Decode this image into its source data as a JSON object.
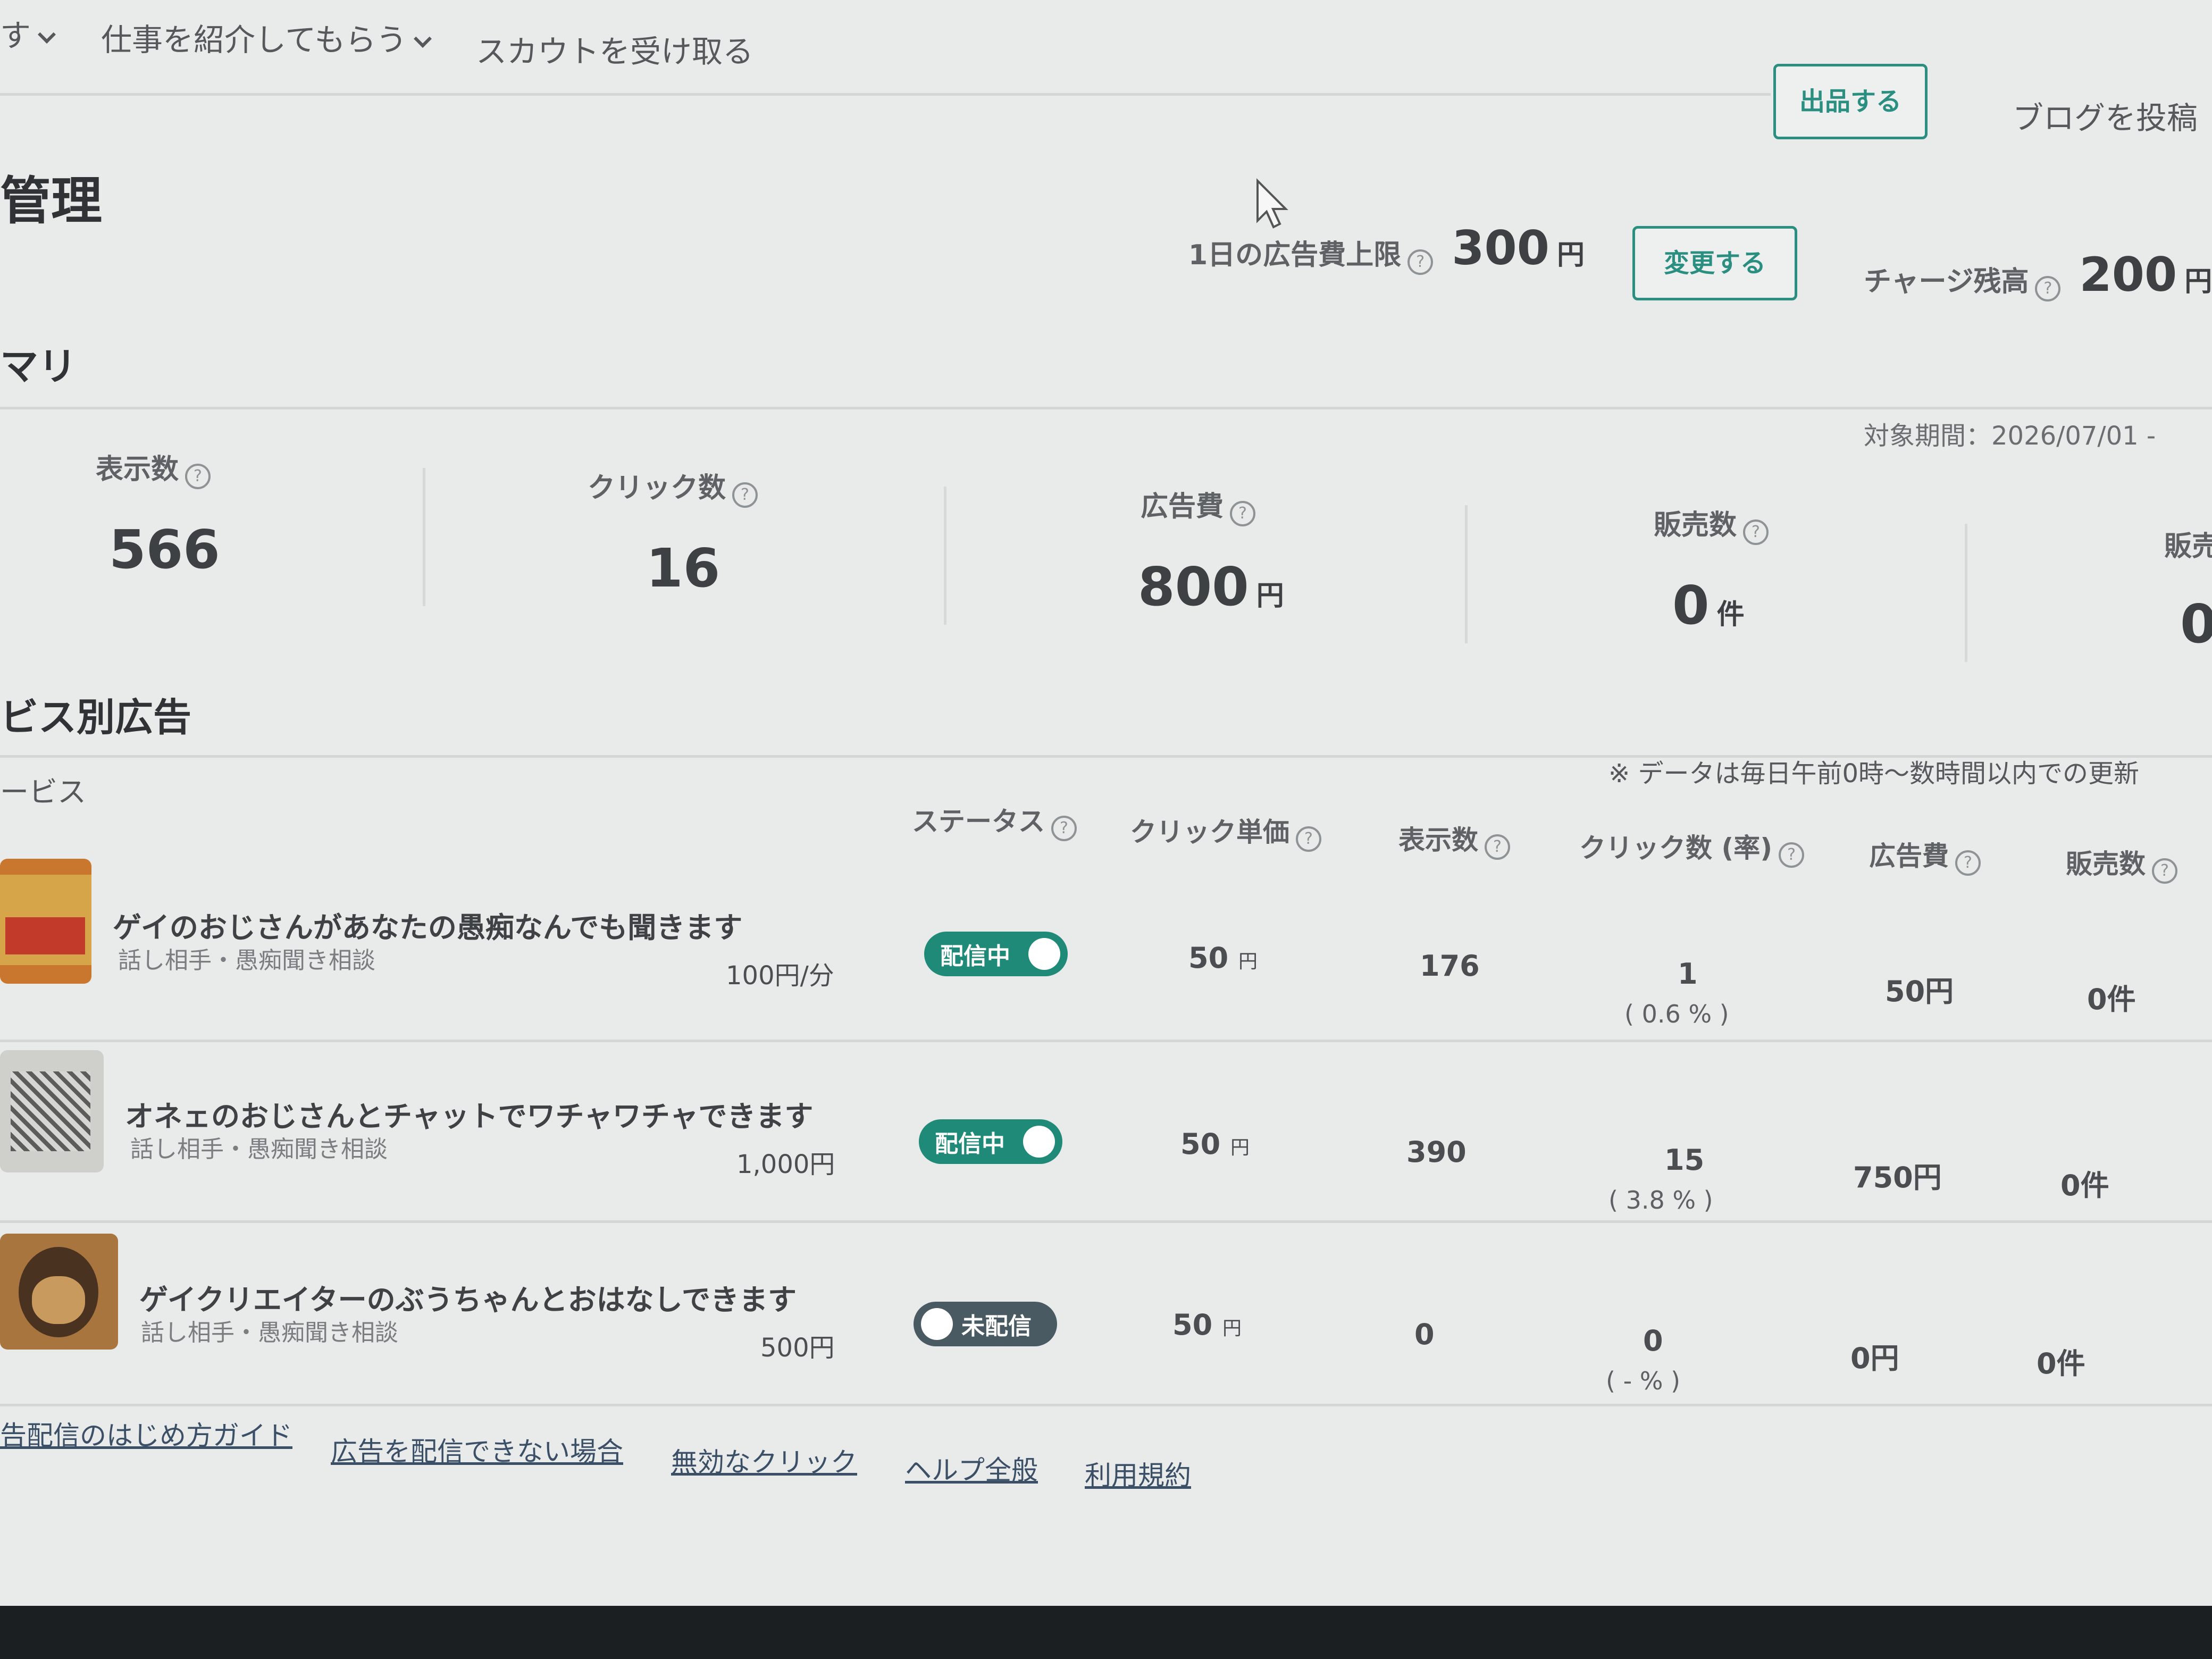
{
  "nav": {
    "item0": "す",
    "item1": "仕事を紹介してもらう",
    "item2": "スカウトを受け取る",
    "sell_button": "出品する",
    "blog_button": "ブログを投稿"
  },
  "page": {
    "title": "管理",
    "daily_limit_label": "1日の広告費上限",
    "daily_limit_value": "300",
    "daily_limit_unit": "円",
    "change_button": "変更する",
    "balance_label": "チャージ残高",
    "balance_value": "200",
    "balance_unit": "円"
  },
  "summary": {
    "heading": "マリ",
    "period": "対象期間：2026/07/01 -",
    "metrics": [
      {
        "label": "表示数",
        "value": "566",
        "unit": ""
      },
      {
        "label": "クリック数",
        "value": "16",
        "unit": ""
      },
      {
        "label": "広告費",
        "value": "800",
        "unit": "円"
      },
      {
        "label": "販売数",
        "value": "0",
        "unit": "件"
      },
      {
        "label": "販売",
        "value": "0",
        "unit": ""
      }
    ]
  },
  "services": {
    "heading": "ビス別広告",
    "column_service": "ービス",
    "update_note": "※ データは毎日午前0時〜数時間以内での更新",
    "columns": {
      "status": "ステータス",
      "cpc": "クリック単価",
      "impressions": "表示数",
      "clicks": "クリック数 (率)",
      "ad_cost": "広告費",
      "sales": "販売数"
    },
    "rows": [
      {
        "title": "ゲイのおじさんがあなたの愚痴なんでも聞きます",
        "category": "話し相手・愚痴聞き相談",
        "price": "100円/分",
        "status": "配信中",
        "status_on": true,
        "cpc": "50",
        "cpc_unit": "円",
        "impressions": "176",
        "clicks": "1",
        "rate": "( 0.6 % )",
        "ad_cost": "50円",
        "sales": "0件"
      },
      {
        "title": "オネェのおじさんとチャットでワチャワチャできます",
        "category": "話し相手・愚痴聞き相談",
        "price": "1,000円",
        "status": "配信中",
        "status_on": true,
        "cpc": "50",
        "cpc_unit": "円",
        "impressions": "390",
        "clicks": "15",
        "rate": "( 3.8 % )",
        "ad_cost": "750円",
        "sales": "0件"
      },
      {
        "title": "ゲイクリエイターのぶうちゃんとおはなしできます",
        "category": "話し相手・愚痴聞き相談",
        "price": "500円",
        "status": "未配信",
        "status_on": false,
        "cpc": "50",
        "cpc_unit": "円",
        "impressions": "0",
        "clicks": "0",
        "rate": "( - % )",
        "ad_cost": "0円",
        "sales": "0件"
      }
    ]
  },
  "footer_links": [
    "告配信のはじめ方ガイド",
    "広告を配信できない場合",
    "無効なクリック",
    "ヘルプ全般",
    "利用規約"
  ],
  "help_icon_glyph": "?",
  "colors": {
    "accent": "#2a8f80",
    "toggle_on": "#1f8a77",
    "toggle_off": "#4a5a63",
    "link": "#3b4f66"
  }
}
